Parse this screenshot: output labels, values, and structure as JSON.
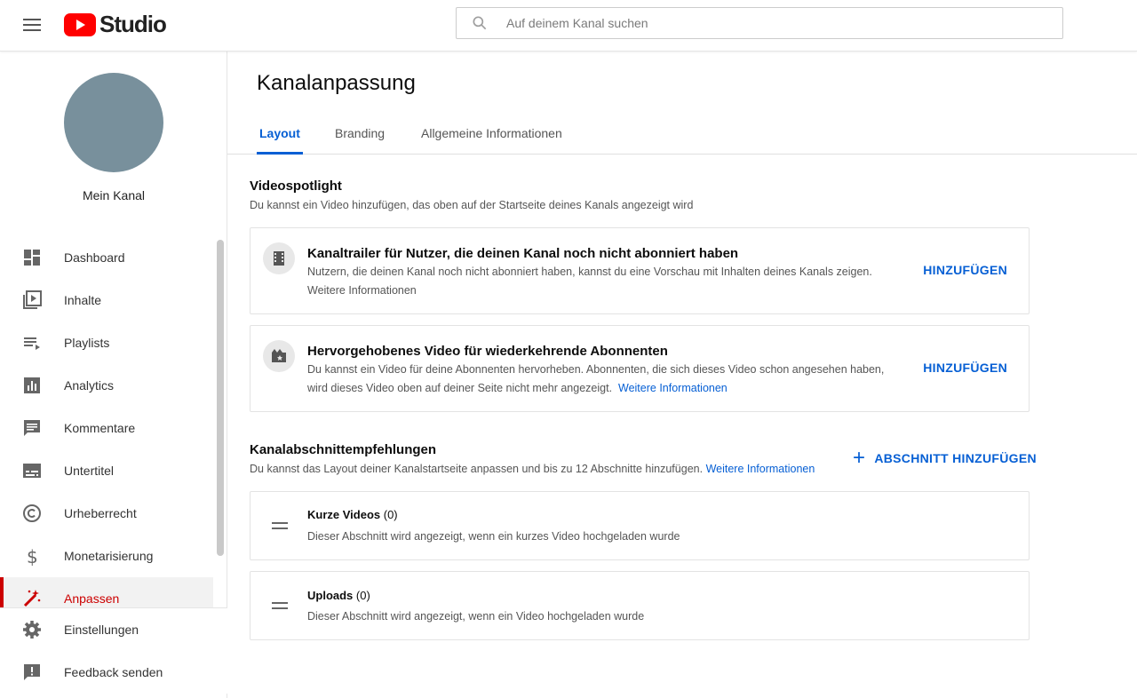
{
  "header": {
    "logo_text": "Studio",
    "search_placeholder": "Auf deinem Kanal suchen"
  },
  "sidebar": {
    "channel_name": "Mein Kanal",
    "items": [
      {
        "label": "Dashboard",
        "icon": "dashboard-icon"
      },
      {
        "label": "Inhalte",
        "icon": "content-icon"
      },
      {
        "label": "Playlists",
        "icon": "playlists-icon"
      },
      {
        "label": "Analytics",
        "icon": "analytics-icon"
      },
      {
        "label": "Kommentare",
        "icon": "comments-icon"
      },
      {
        "label": "Untertitel",
        "icon": "subtitles-icon"
      },
      {
        "label": "Urheberrecht",
        "icon": "copyright-icon"
      },
      {
        "label": "Monetarisierung",
        "icon": "dollar-icon"
      },
      {
        "label": "Anpassen",
        "icon": "customize-icon",
        "active": true
      }
    ],
    "bottom_items": [
      {
        "label": "Einstellungen",
        "icon": "settings-icon"
      },
      {
        "label": "Feedback senden",
        "icon": "feedback-icon"
      }
    ]
  },
  "main": {
    "title": "Kanalanpassung",
    "tabs": [
      {
        "label": "Layout",
        "active": true
      },
      {
        "label": "Branding"
      },
      {
        "label": "Allgemeine Informationen"
      }
    ],
    "spotlight": {
      "title": "Videospotlight",
      "subtitle": "Du kannst ein Video hinzufügen, das oben auf der Startseite deines Kanals angezeigt wird",
      "cards": [
        {
          "title": "Kanaltrailer für Nutzer, die deinen Kanal noch nicht abonniert haben",
          "text": "Nutzern, die deinen Kanal noch nicht abonniert haben, kannst du eine Vorschau mit Inhalten deines Kanals zeigen.",
          "link": "Weitere Informationen",
          "action": "HINZUFÜGEN"
        },
        {
          "title": "Hervorgehobenes Video für wiederkehrende Abonnenten",
          "text_line1": "Du kannst ein Video für deine Abonnenten hervorheben. Abonnenten, die sich dieses Video schon angesehen haben,",
          "text_line2": "wird dieses Video oben auf deiner Seite nicht mehr angezeigt.",
          "link": "Weitere Informationen",
          "action": "HINZUFÜGEN"
        }
      ]
    },
    "sections": {
      "title": "Kanalabschnittempfehlungen",
      "subtitle": "Du kannst das Layout deiner Kanalstartseite anpassen und bis zu 12 Abschnitte hinzufügen.",
      "link": "Weitere Informationen",
      "add_label": "ABSCHNITT HINZUFÜGEN",
      "rows": [
        {
          "name": "Kurze Videos",
          "count": "(0)",
          "desc": "Dieser Abschnitt wird angezeigt, wenn ein kurzes Video hochgeladen wurde"
        },
        {
          "name": "Uploads",
          "count": "(0)",
          "desc": "Dieser Abschnitt wird angezeigt, wenn ein Video hochgeladen wurde"
        }
      ]
    }
  },
  "colors": {
    "accent": "#065fd4",
    "brand_red": "#ff0000",
    "active_red": "#cc0000",
    "avatar": "#78909c"
  }
}
